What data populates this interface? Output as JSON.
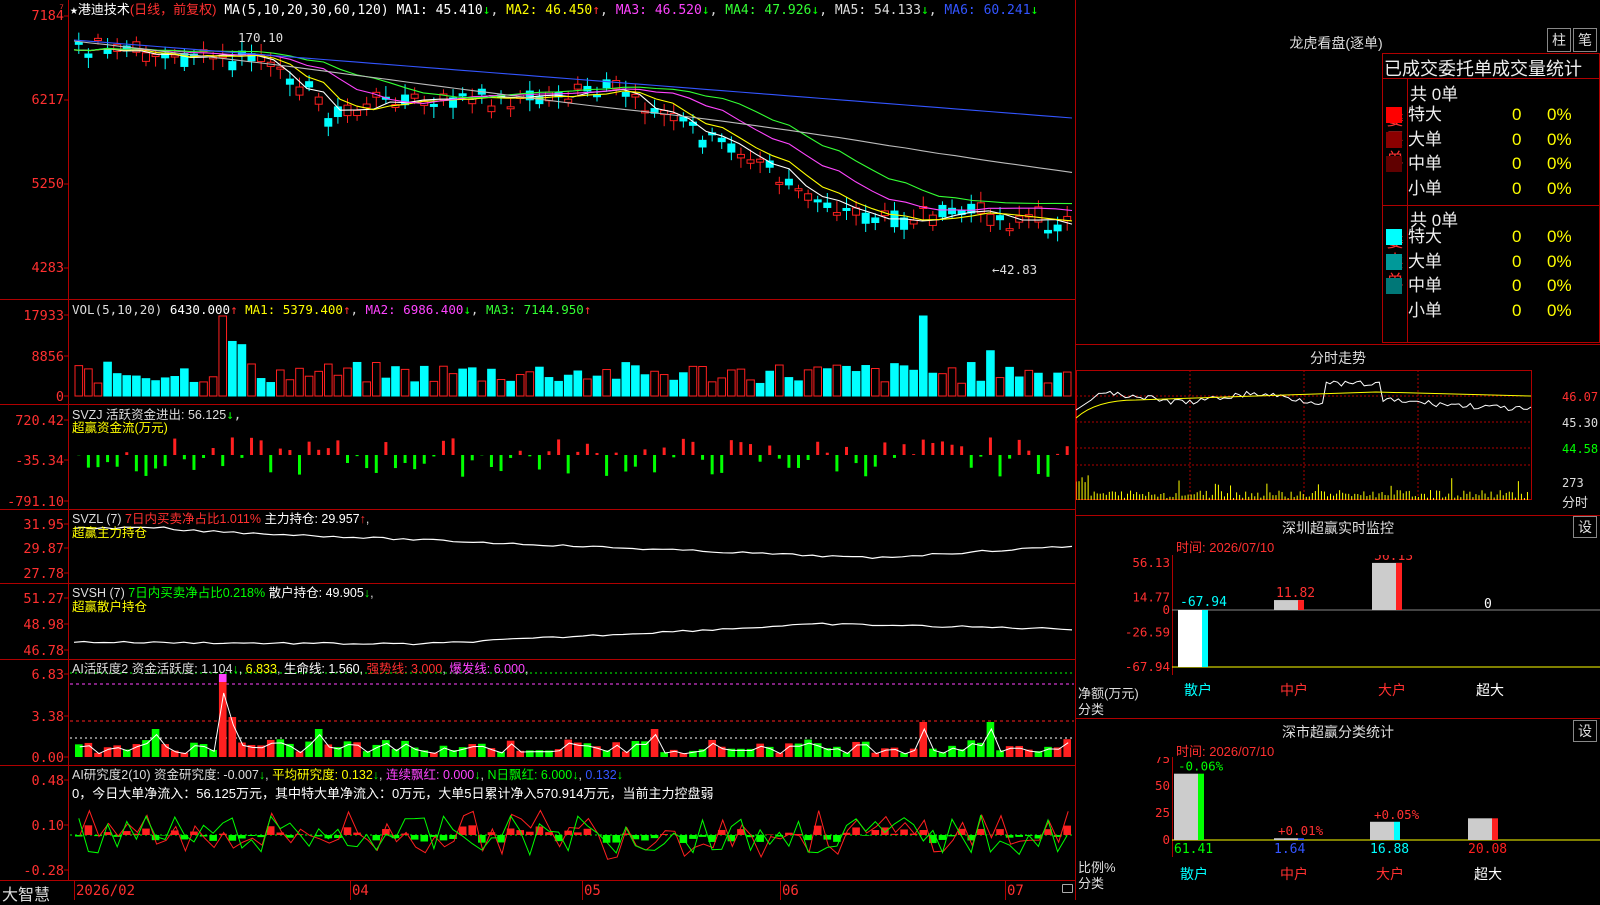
{
  "header": {
    "star": "★",
    "stock_name": "港迪技术",
    "period": "(日线，前复权)",
    "ma_label": "MA(5,10,20,30,60,120)",
    "ma_items": [
      {
        "label": "MA1: 45.410",
        "arrow": "↓",
        "color": "#ffffff"
      },
      {
        "label": "MA2: 46.450",
        "arrow": "↑",
        "color": "#ffff00"
      },
      {
        "label": "MA3: 46.520",
        "arrow": "↓",
        "color": "#ff44ff"
      },
      {
        "label": "MA4: 47.926",
        "arrow": "↓",
        "color": "#33ff33"
      },
      {
        "label": "MA5: 54.133",
        "arrow": "↓",
        "color": "#dddddd"
      },
      {
        "label": "MA6: 60.241",
        "arrow": "↓",
        "color": "#3355ff"
      }
    ]
  },
  "price_pane": {
    "y_labels": [
      "7184",
      "6217",
      "5250",
      "4283"
    ],
    "high_marker": "170.10",
    "low_marker": "←42.83"
  },
  "vol_pane": {
    "title": "VOL(5,10,20)",
    "value": "6430.000",
    "items": [
      {
        "label": "MA1: 5379.400",
        "arrow": "↑",
        "color": "#ffff00"
      },
      {
        "label": "MA2: 6986.400",
        "arrow": "↓",
        "color": "#ff44ff"
      },
      {
        "label": "MA3: 7144.950",
        "arrow": "↑",
        "color": "#33ff33"
      }
    ],
    "y_labels": [
      "17933",
      "8856",
      "0"
    ]
  },
  "svzj_pane": {
    "title": "SVZJ  活跃资金进出: 56.125",
    "arrow": "↓",
    "subtitle": "超赢资金流(万元)",
    "y_labels": [
      "720.42",
      "-35.34",
      "-791.10"
    ]
  },
  "svzl_pane": {
    "title": "SVZL (7)",
    "ratio": "7日内买卖净占比1.011%",
    "hold": "主力持仓: 29.957",
    "arrow": "↑",
    "subtitle": "超赢主力持仓",
    "y_labels": [
      "31.95",
      "29.87",
      "27.78"
    ]
  },
  "svsh_pane": {
    "title": "SVSH (7)",
    "ratio": "7日内买卖净占比0.218%",
    "hold": "散户持仓: 49.905",
    "arrow": "↓",
    "subtitle": "超赢散户持仓",
    "y_labels": [
      "51.27",
      "48.98",
      "46.78"
    ]
  },
  "ai_active_pane": {
    "title": "AI活跃度2 资金活跃度: 1.104",
    "v2": "6.833",
    "v3": "生命线: 1.560",
    "v4": "强势线: 3.000",
    "v5": "爆发线: 6.000",
    "y_labels": [
      "6.83",
      "3.38",
      "0.00"
    ]
  },
  "ai_research_pane": {
    "title": "AI研究度2(10) 资金研究度: -0.007",
    "v2": "平均研究度: 0.132",
    "v3": "连续飘红: 0.000",
    "v4": "N日飘红: 6.000",
    "v5": "0.132",
    "summary": "0，今日大单净流入：56.125万元，其中特大单净流入：0万元，大单5日累计净入570.914万元，当前主力控盘弱",
    "y_labels": [
      "0.48",
      "0.10",
      "-0.28"
    ]
  },
  "footer": {
    "brand": "大智慧",
    "dates": [
      "2026/02",
      "04",
      "05",
      "06",
      "07"
    ]
  },
  "right_panel": {
    "lhb_title": "龙虎看盘(逐单)",
    "btn_zhu": "柱",
    "btn_bi": "笔",
    "stats_header": "已成交委托单成交量统计",
    "buy_side": {
      "label": [
        "委",
        "买",
        "单"
      ],
      "total": "共 0单",
      "rows": [
        {
          "name": "特大",
          "qty": "0",
          "pct": "0%",
          "color": "#ff0000"
        },
        {
          "name": "大单",
          "qty": "0",
          "pct": "0%",
          "color": "#8b0000"
        },
        {
          "name": "中单",
          "qty": "0",
          "pct": "0%",
          "color": "#600000"
        },
        {
          "name": "小单",
          "qty": "0",
          "pct": "0%",
          "color": ""
        }
      ]
    },
    "sell_side": {
      "label": [
        "委",
        "卖",
        "单"
      ],
      "total": "共 0单",
      "rows": [
        {
          "name": "特大",
          "qty": "0",
          "pct": "0%",
          "color": "#00ffff"
        },
        {
          "name": "大单",
          "qty": "0",
          "pct": "0%",
          "color": "#009999"
        },
        {
          "name": "中单",
          "qty": "0",
          "pct": "0%",
          "color": "#007777"
        },
        {
          "name": "小单",
          "qty": "0",
          "pct": "0%",
          "color": ""
        }
      ]
    },
    "intraday": {
      "title": "分时走势",
      "y_labels": [
        "46.07",
        "45.30",
        "44.58"
      ],
      "vol_label": "273",
      "vol_caption": "分时"
    },
    "monitor": {
      "title": "深圳超赢实时监控",
      "btn": "设",
      "time": "时间: 2026/07/10",
      "y_labels": [
        "56.13",
        "14.77",
        "0",
        "-26.59",
        "-67.94"
      ],
      "axis_caption1": "净额(万元)",
      "axis_caption2": "分类",
      "categories": [
        "散户",
        "中户",
        "大户",
        "超大"
      ],
      "values": [
        "-67.94",
        "11.82",
        "56.13",
        "0"
      ]
    },
    "classify": {
      "title": "深市超赢分类统计",
      "btn": "设",
      "time": "时间: 2026/07/10",
      "y_labels": [
        "75",
        "50",
        "25",
        "0"
      ],
      "axis_caption1": "比例%",
      "axis_caption2": "分类",
      "categories": [
        "散户",
        "中户",
        "大户",
        "超大"
      ],
      "values": [
        "61.41",
        "1.64",
        "16.88",
        "20.08"
      ],
      "deltas": [
        "-0.06%",
        "+0.01%",
        "+0.05%",
        ""
      ]
    }
  }
}
